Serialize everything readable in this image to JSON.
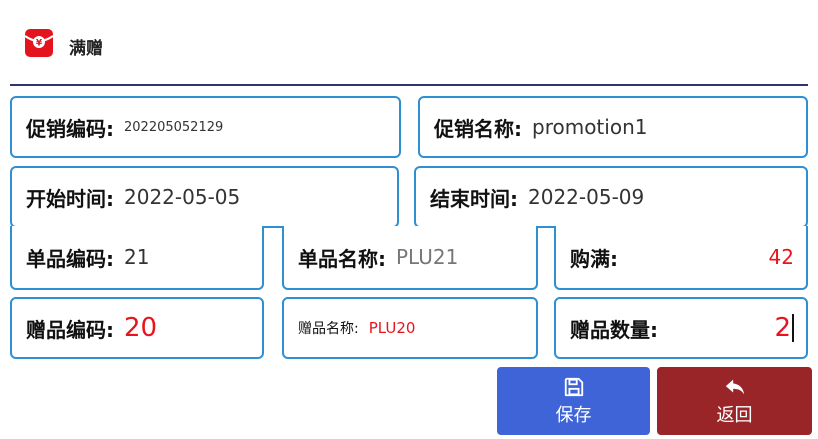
{
  "header": {
    "title": "满赠",
    "logo_icon": "red-envelope-yuan-icon"
  },
  "form": {
    "promo_code": {
      "label": "促销编码:",
      "value": "202205052129"
    },
    "promo_name": {
      "label": "促销名称:",
      "value": "promotion1"
    },
    "start_time": {
      "label": "开始时间:",
      "value": "2022-05-05"
    },
    "end_time": {
      "label": "结束时间:",
      "value": "2022-05-09"
    },
    "item_code": {
      "label": "单品编码:",
      "value": "21"
    },
    "item_name": {
      "label": "单品名称:",
      "value": "PLU21"
    },
    "purchase_full": {
      "label": "购满:",
      "value": "42"
    },
    "gift_code": {
      "label": "赠品编码:",
      "value": "20"
    },
    "gift_name": {
      "label": "赠品名称:",
      "value": "PLU20"
    },
    "gift_qty": {
      "label": "赠品数量:",
      "value": "2"
    }
  },
  "buttons": {
    "save": {
      "label": "保存",
      "icon": "floppy-disk-icon"
    },
    "back": {
      "label": "返回",
      "icon": "reply-arrow-icon"
    }
  },
  "colors": {
    "accent_border": "#2f8fd3",
    "save_bg": "#3f64d8",
    "back_bg": "#9a2528",
    "value_red": "#e8141d"
  }
}
